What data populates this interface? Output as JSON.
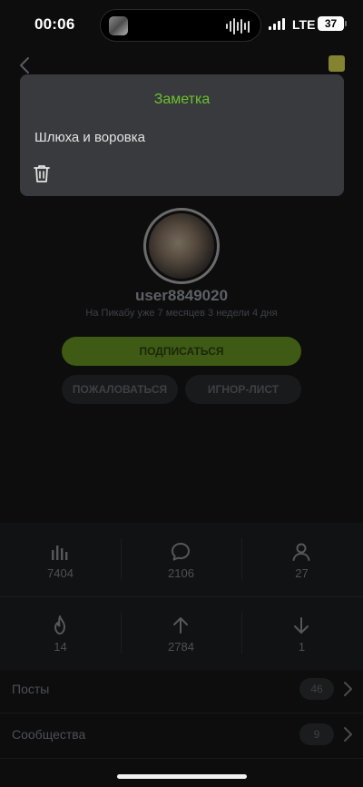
{
  "status_bar": {
    "time": "00:06",
    "network": "LTE",
    "battery": "37"
  },
  "note": {
    "title": "Заметка",
    "text": "Шлюха и воровка"
  },
  "profile": {
    "username": "user8849020",
    "member_since": "На Пикабу уже 7 месяцев 3 недели 4 дня"
  },
  "buttons": {
    "subscribe": "ПОДПИСАТЬСЯ",
    "report": "ПОЖАЛОВАТЬСЯ",
    "ignore": "ИГНОР-ЛИСТ"
  },
  "stats": [
    {
      "icon": "bar-chart-icon",
      "value": "7404"
    },
    {
      "icon": "comment-icon",
      "value": "2106"
    },
    {
      "icon": "person-icon",
      "value": "27"
    },
    {
      "icon": "fire-icon",
      "value": "14"
    },
    {
      "icon": "arrow-up-icon",
      "value": "2784"
    },
    {
      "icon": "arrow-down-icon",
      "value": "1"
    }
  ],
  "sections": [
    {
      "label": "Посты",
      "count": "46"
    },
    {
      "label": "Сообщества",
      "count": "9"
    }
  ],
  "colors": {
    "accent_green": "#6cc12a",
    "popup_bg": "#383a3e",
    "subscribe_bg": "#3e5a14"
  }
}
